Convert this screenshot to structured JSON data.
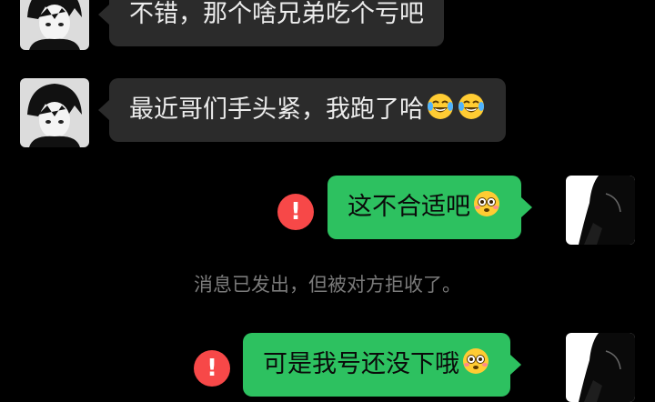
{
  "messages": [
    {
      "side": "left",
      "text": "不错，那个啥兄弟吃个亏吧",
      "emojis": []
    },
    {
      "side": "left",
      "text": "最近哥们手头紧，我跑了哈",
      "emojis": [
        "tears-of-joy-emoji",
        "tears-of-joy-emoji"
      ]
    },
    {
      "side": "right",
      "text": "这不合适吧",
      "emojis": [
        "flushed-face-emoji"
      ],
      "alert": "!"
    },
    {
      "side": "right",
      "text": "可是我号还没下哦",
      "emojis": [
        "flushed-face-emoji"
      ],
      "alert": "!"
    }
  ],
  "system_notice": "消息已发出，但被对方拒收了。",
  "colors": {
    "background": "#000000",
    "incoming_bubble": "#2b2b2b",
    "outgoing_bubble": "#2dc160",
    "alert": "#f74848",
    "notice_text": "#7a7a7a"
  }
}
